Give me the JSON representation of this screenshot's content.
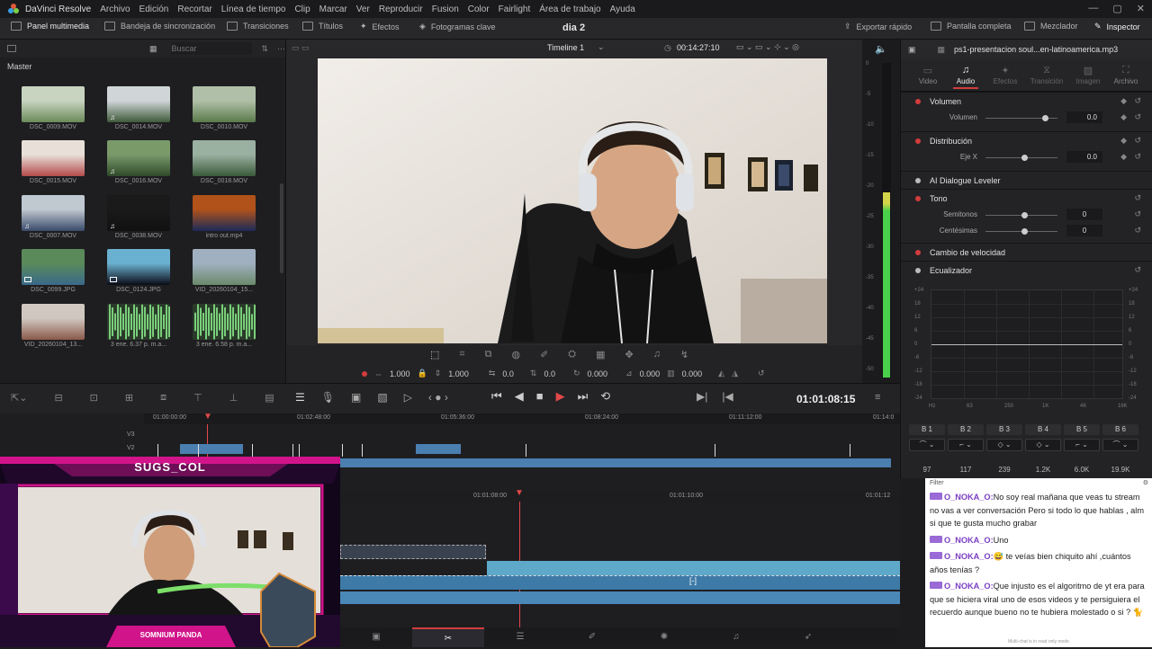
{
  "menubar": {
    "app": "DaVinci Resolve",
    "items": [
      "Archivo",
      "Edición",
      "Recortar",
      "Línea de tiempo",
      "Clip",
      "Marcar",
      "Ver",
      "Reproducir",
      "Fusion",
      "Color",
      "Fairlight",
      "Área de trabajo",
      "Ayuda"
    ]
  },
  "toolbar": {
    "media_pool": "Panel multimedia",
    "sync_bin": "Bandeja de sincronización",
    "transitions": "Transiciones",
    "titles": "Títulos",
    "effects": "Efectos",
    "keyframes": "Fotogramas clave",
    "project": "dia 2",
    "quick_export": "Exportar rápido",
    "fullscreen": "Pantalla completa",
    "mixer": "Mezclador",
    "inspector": "Inspector"
  },
  "media": {
    "search_placeholder": "Buscar",
    "bin": "Master",
    "clips": [
      {
        "name": "DSC_0009.MOV",
        "kind": "video"
      },
      {
        "name": "DSC_0014.MOV",
        "kind": "video"
      },
      {
        "name": "DSC_0010.MOV",
        "kind": "video"
      },
      {
        "name": "DSC_0015.MOV",
        "kind": "video"
      },
      {
        "name": "DSC_0016.MOV",
        "kind": "video"
      },
      {
        "name": "DSC_0018.MOV",
        "kind": "video"
      },
      {
        "name": "DSC_0007.MOV",
        "kind": "video"
      },
      {
        "name": "DSC_0038.MOV",
        "kind": "video"
      },
      {
        "name": "intro out.mp4",
        "kind": "video"
      },
      {
        "name": "DSC_0099.JPG",
        "kind": "image"
      },
      {
        "name": "DSC_0124.JPG",
        "kind": "image"
      },
      {
        "name": "VID_20260104_15...",
        "kind": "video"
      },
      {
        "name": "VID_20260104_13...",
        "kind": "video"
      },
      {
        "name": "3 ene. 6.37 p. m.a...",
        "kind": "audio"
      },
      {
        "name": "3 ene. 6.58 p. m.a...",
        "kind": "audio"
      }
    ]
  },
  "viewer": {
    "timeline_name": "Timeline 1",
    "source_tc": "00:14:27:10",
    "zoom_x": "1.000",
    "zoom_y": "1.000",
    "pos_x": "0.0",
    "pos_y": "0.0",
    "rotation": "0.000",
    "crop_a": "0.000",
    "crop_b": "0.000"
  },
  "meter": {
    "scale": [
      "0",
      "-5",
      "-10",
      "-15",
      "-20",
      "-25",
      "-30",
      "-35",
      "-40",
      "-45",
      "-50"
    ],
    "level": 0.12
  },
  "transport": {
    "timecode": "01:01:08:15"
  },
  "timeline": {
    "ruler_top": [
      "01:00:00:00",
      "01:02:48:00",
      "01:05:36:00",
      "01:08:24:00",
      "01:11:12:00",
      "01:14:0"
    ],
    "tracks": [
      "V3",
      "V2"
    ],
    "ruler_bottom": [
      "01:01:08:00",
      "01:01:10:00",
      "01:01:12"
    ]
  },
  "inspector": {
    "file": "ps1-presentacion soul...en-latinoamerica.mp3",
    "tabs": [
      "Video",
      "Audio",
      "Efectos",
      "Transición",
      "Imagen",
      "Archivo"
    ],
    "active_tab": "Audio",
    "volume_title": "Volumen",
    "volume_label": "Volumen",
    "volume_value": "0.0",
    "pan_title": "Distribución",
    "pan_label": "Eje X",
    "pan_value": "0.0",
    "leveler": "AI Dialogue Leveler",
    "pitch_title": "Tono",
    "semitones_label": "Semitonos",
    "semitones_value": "0",
    "cents_label": "Centésimas",
    "cents_value": "0",
    "speed": "Cambio de velocidad",
    "eq": "Ecualizador",
    "eq_db": [
      "+24",
      "18",
      "12",
      "6",
      "0",
      "-6",
      "-12",
      "-18",
      "-24"
    ],
    "eq_freq": [
      "Hz",
      "63",
      "250",
      "1K",
      "4K",
      "16K"
    ],
    "bands": [
      {
        "label": "B 1",
        "value": "97"
      },
      {
        "label": "B 2",
        "value": "117"
      },
      {
        "label": "B 3",
        "value": "239"
      },
      {
        "label": "B 4",
        "value": "1.2K"
      },
      {
        "label": "B 5",
        "value": "6.0K"
      },
      {
        "label": "B 6",
        "value": "19.9K"
      }
    ]
  },
  "overlay": {
    "streamer": "SUGS_COL",
    "nameplate": "SOMNIUM PANDA"
  },
  "chat": {
    "filter": "Filter",
    "messages": [
      {
        "user": "O_NOKA_O:",
        "text": "No soy real mañana que veas tu stream no vas a ver conversación Pero si todo lo que hablas , alm si que te gusta mucho grabar"
      },
      {
        "user": "O_NOKA_O:",
        "text": "Uno"
      },
      {
        "user": "O_NOKA_O:",
        "text": "😅 te veías bien chiquito ahí ,cuántos años tenías ?"
      },
      {
        "user": "O_NOKA_O:",
        "text": "Que injusto es el algoritmo de yt era para que se hiciera viral uno de esos videos y te persiguiera el recuerdo aunque bueno no te hubiera molestado o si ? 🐈"
      }
    ],
    "footer": "Multi-chat is in read only mode"
  },
  "pages": [
    "media",
    "cut",
    "edit",
    "fusion",
    "color",
    "fairlight",
    "deliver"
  ],
  "colors": {
    "accent": "#d23c3c",
    "clip": "#4a7fb0",
    "audio": "#5ea9c9",
    "chat_user": "#7b3fc4"
  }
}
